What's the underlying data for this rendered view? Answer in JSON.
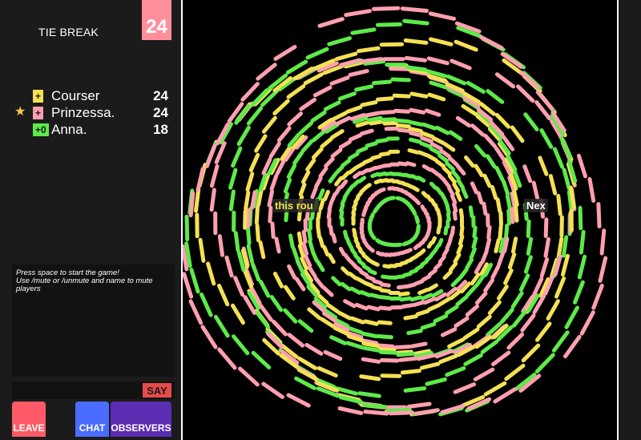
{
  "header": {
    "tie_break_label": "TIE BREAK",
    "target_score": "24"
  },
  "players": [
    {
      "name": "Courser",
      "badge": "+",
      "score": "24",
      "color": "#f4e154",
      "leader": false
    },
    {
      "name": "Prinzessa.",
      "badge": "+",
      "score": "24",
      "color": "#ff9fb0",
      "leader": true
    },
    {
      "name": "Anna.",
      "badge": "+0",
      "score": "18",
      "color": "#5eea4a",
      "leader": false
    }
  ],
  "chat": {
    "log": "Press space to start the game!\nUse /mute or /unmute and name to mute players",
    "input_value": "",
    "say_label": "SAY"
  },
  "buttons": {
    "leave": "LEAVE",
    "chat": "CHAT",
    "observers": "OBSERVERS"
  },
  "board": {
    "round_text": "this rou",
    "next_text": "Nex"
  },
  "colors": {
    "yellow": "#f4e154",
    "pink": "#ff9fb0",
    "green": "#5eea4a"
  }
}
